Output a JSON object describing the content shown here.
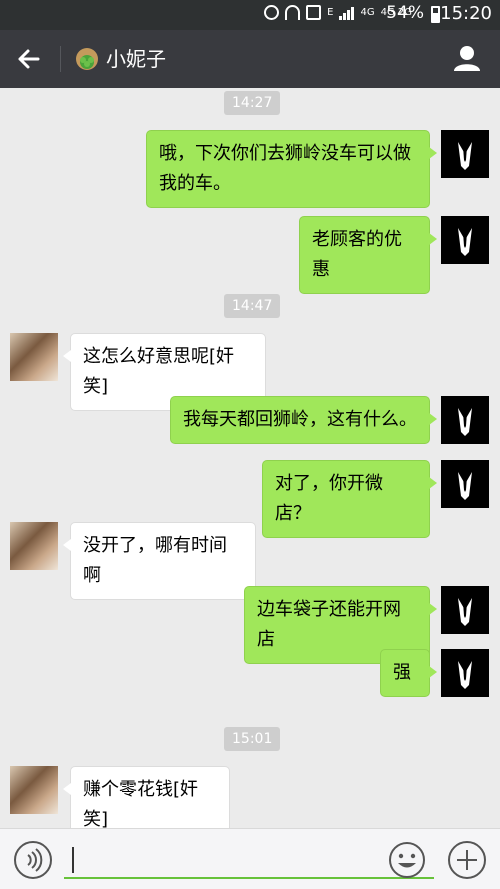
{
  "status_bar": {
    "network_1": "E",
    "network_2": "4G",
    "network_3": "4G 2G",
    "battery": "54%",
    "time": "15:20"
  },
  "header": {
    "title": "小妮子"
  },
  "chat": {
    "timestamps": [
      "14:27",
      "14:47",
      "15:01"
    ],
    "messages": [
      {
        "side": "out",
        "text": "哦，下次你们去狮岭没车可以做我的车。"
      },
      {
        "side": "out",
        "text": "老顾客的优惠"
      },
      {
        "side": "in",
        "text": "这怎么好意思呢[奸笑]"
      },
      {
        "side": "out",
        "text": "我每天都回狮岭，这有什么。"
      },
      {
        "side": "out",
        "text": "对了，你开微店？"
      },
      {
        "side": "in",
        "text": "没开了，哪有时间啊"
      },
      {
        "side": "out",
        "text": "边车袋子还能开网店"
      },
      {
        "side": "out",
        "text": "强"
      },
      {
        "side": "in",
        "text": "赚个零花钱[奸笑]"
      }
    ]
  },
  "input_bar": {
    "value": ""
  },
  "colors": {
    "outgoing_bubble": "#a0e75a",
    "incoming_bubble": "#ffffff",
    "header_bg": "#393a3f",
    "status_bg": "#2e3132",
    "input_underline": "#67c23a"
  },
  "icons": {
    "back": "arrow-left-icon",
    "profile": "person-icon",
    "voice": "voice-icon",
    "emoji": "smiley-icon",
    "plus": "plus-icon"
  }
}
